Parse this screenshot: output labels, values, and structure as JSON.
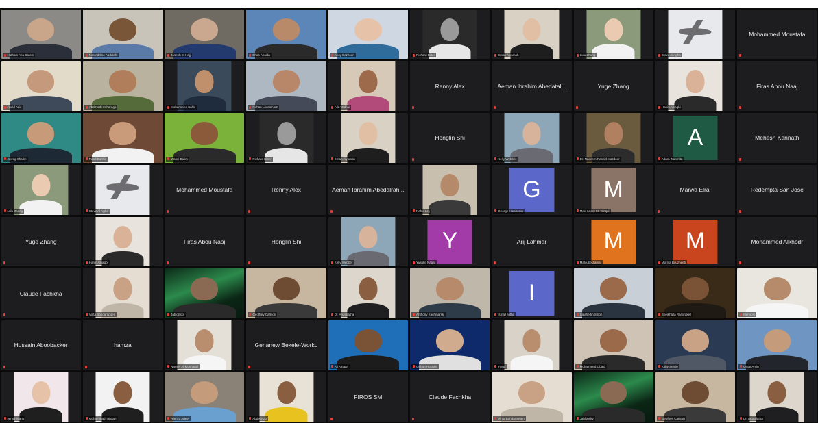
{
  "tiles": [
    {
      "kind": "video",
      "name": "Hatham Abu Salem",
      "bg": "#8c8a86",
      "skin": "#c9a68a",
      "shirt": "#2b2f3a",
      "full": true
    },
    {
      "kind": "video",
      "name": "Nasreddine Abdulahi",
      "bg": "#c9c4b9",
      "skin": "#7a5638",
      "shirt": "#5a7aa8",
      "full": true
    },
    {
      "kind": "video",
      "name": "Joseph El Hajj",
      "bg": "#6f6b63",
      "skin": "#caa78f",
      "shirt": "#233a6e",
      "full": true
    },
    {
      "kind": "video",
      "name": "Ehab Ahaida",
      "bg": "#5d86b8",
      "skin": "#b88a6a",
      "shirt": "#2a2a2a",
      "full": true
    },
    {
      "kind": "video",
      "name": "Ahoy Bazzoun",
      "bg": "#cfd8e2",
      "skin": "#e6c3a8",
      "shirt": "#2f6c9c",
      "full": true
    },
    {
      "kind": "video",
      "name": "Richard Bitter",
      "bg": "#2a2a2a",
      "skin": "#9a9a9a",
      "shirt": "#e6e6e6",
      "full": false
    },
    {
      "kind": "video",
      "name": "Eman Alyamah",
      "bg": "#d9d2c4",
      "skin": "#e0bfa4",
      "shirt": "#1e1e1e",
      "full": false
    },
    {
      "kind": "video",
      "name": "Lulu Zhang",
      "bg": "#8a9a7a",
      "skin": "#eacbb2",
      "shirt": "#f2f2f2",
      "full": false
    },
    {
      "kind": "plane",
      "name": "Steve Al Agha",
      "bg": "#e7e9ec",
      "full": false
    },
    {
      "kind": "text",
      "name": "Mohammed Moustafa"
    },
    {
      "kind": "video",
      "name": "Abdul Aziz",
      "bg": "#e3dbc9",
      "skin": "#c59a7c",
      "shirt": "#3e4a5a",
      "full": true
    },
    {
      "kind": "video",
      "name": "Abd Kader Sharaga",
      "bg": "#b9b29f",
      "skin": "#b07e5b",
      "shirt": "#556b3a",
      "full": true
    },
    {
      "kind": "video",
      "name": "Mohammed Sahir",
      "bg": "#3a4a5a",
      "skin": "#c0906c",
      "shirt": "#1f2c3d",
      "full": false
    },
    {
      "kind": "video",
      "name": "Rohan Lovesmorz",
      "bg": "#aeb8c2",
      "skin": "#b8876a",
      "shirt": "#444a58",
      "full": true
    },
    {
      "kind": "video",
      "name": "Aila Vadhai",
      "bg": "#d6c9b8",
      "skin": "#9e6a4c",
      "shirt": "#b24a7a",
      "full": false
    },
    {
      "kind": "text",
      "name": "Renny Alex"
    },
    {
      "kind": "text",
      "name": "Aeman Ibrahim Abedatal..."
    },
    {
      "kind": "text",
      "name": "Yuge Zhang"
    },
    {
      "kind": "video",
      "name": "Hanin Alnaqbi",
      "bg": "#e8e3dc",
      "skin": "#d9b298",
      "shirt": "#2a2a2a",
      "full": false
    },
    {
      "kind": "text",
      "name": "Firas Abou Naaj"
    },
    {
      "kind": "video",
      "name": "Jaweg Shaikh",
      "bg": "#2f8a86",
      "skin": "#c79b7a",
      "shirt": "#1d2a35",
      "full": true
    },
    {
      "kind": "video",
      "name": "Raad Bachir",
      "bg": "#6e4a36",
      "skin": "#c99b7b",
      "shirt": "#f2f2f2",
      "full": true
    },
    {
      "kind": "video",
      "name": "Wanzi Bajim",
      "bg": "#7bb23a",
      "skin": "#8a5a3a",
      "shirt": "#2a2a2a",
      "full": true
    },
    {
      "kind": "video",
      "name": "Richard Bitter",
      "bg": "#2a2a2a",
      "skin": "#9a9a9a",
      "shirt": "#e6e6e6",
      "full": false
    },
    {
      "kind": "video",
      "name": "Eman Alyamah",
      "bg": "#d9d2c4",
      "skin": "#e0bfa4",
      "shirt": "#1e1e1e",
      "full": false
    },
    {
      "kind": "text",
      "name": "Honglin Shi"
    },
    {
      "kind": "video",
      "name": "Kelly Webber",
      "bg": "#8ea7b8",
      "skin": "#d6b39a",
      "shirt": "#6a6a72",
      "full": false
    },
    {
      "kind": "video",
      "name": "Dr. Nadeem Rashid Mazdoor",
      "bg": "#6a5a3e",
      "skin": "#b08060",
      "shirt": "#2c2c2c",
      "full": false
    },
    {
      "kind": "avatar",
      "letter": "A",
      "color": "#1f5a44",
      "name": "Adam Zammita"
    },
    {
      "kind": "text",
      "name": "Mehesh Kannath"
    },
    {
      "kind": "video",
      "name": "Lulu Zhang",
      "bg": "#8a9a7a",
      "skin": "#eacbb2",
      "shirt": "#f2f2f2",
      "full": false
    },
    {
      "kind": "plane",
      "name": "Steve Al Agha",
      "bg": "#e7e9ec",
      "full": false
    },
    {
      "kind": "text",
      "name": "Mohammed Moustafa"
    },
    {
      "kind": "text",
      "name": "Renny Alex"
    },
    {
      "kind": "text",
      "name": "Aeman Ibrahim Abedalrah..."
    },
    {
      "kind": "video",
      "name": "Nahid Ley",
      "bg": "#c8bfae",
      "skin": "#b58a6a",
      "shirt": "#3a3a3a",
      "full": false
    },
    {
      "kind": "avatar",
      "letter": "G",
      "color": "#5b67c9",
      "name": "George Hambrook"
    },
    {
      "kind": "avatar",
      "letter": "M",
      "color": "#8a7468",
      "name": "Mae Kassy M. Tanqui"
    },
    {
      "kind": "text",
      "name": "Marwa Elrai"
    },
    {
      "kind": "text",
      "name": "Redempta San Jose"
    },
    {
      "kind": "text",
      "name": "Yuge Zhang"
    },
    {
      "kind": "video",
      "name": "Hanin Alnaqbi",
      "bg": "#e8e3dc",
      "skin": "#d9b298",
      "shirt": "#2a2a2a",
      "full": false
    },
    {
      "kind": "text",
      "name": "Firas Abou Naaj"
    },
    {
      "kind": "text",
      "name": "Honglin Shi"
    },
    {
      "kind": "video",
      "name": "Kelly Webber",
      "bg": "#8ea7b8",
      "skin": "#d6b39a",
      "shirt": "#6a6a72",
      "full": false
    },
    {
      "kind": "avatar",
      "letter": "Y",
      "color": "#a23aa8",
      "name": "Yusuke Nagai"
    },
    {
      "kind": "text",
      "name": "Arij Lahmar"
    },
    {
      "kind": "avatar",
      "letter": "M",
      "color": "#e0731e",
      "name": "Maloube Zamar"
    },
    {
      "kind": "avatar",
      "letter": "M",
      "color": "#c9451e",
      "name": "Morina Bouzheeb"
    },
    {
      "kind": "text",
      "name": "Mohammed Alkhodr"
    },
    {
      "kind": "text",
      "name": "Claude Fachkha"
    },
    {
      "kind": "video",
      "name": "Vinta Bandaragoen",
      "bg": "#e6ddd2",
      "skin": "#c9a184",
      "shirt": "#c0b6a8",
      "full": false
    },
    {
      "kind": "aurora",
      "name": "Jablonsky",
      "full": true
    },
    {
      "kind": "video",
      "name": "Geoffrey Carlson",
      "bg": "#c8b7a0",
      "skin": "#6e4c34",
      "shirt": "#3a3a3a",
      "full": true
    },
    {
      "kind": "video",
      "name": "Dr. Arunalatha",
      "bg": "#dcd6cc",
      "skin": "#8a5e40",
      "shirt": "#1f1f22",
      "full": false
    },
    {
      "kind": "video",
      "name": "Anthony Kachmarski",
      "bg": "#bfb7aa",
      "skin": "#b88a6c",
      "shirt": "#2e3b48",
      "full": true
    },
    {
      "kind": "avatar",
      "letter": "I",
      "color": "#5b67c9",
      "name": "Ismail Mitha"
    },
    {
      "kind": "video",
      "name": "Salahedin Singh",
      "bg": "#c9cfd6",
      "skin": "#9a6a4a",
      "shirt": "#2a3340",
      "full": true
    },
    {
      "kind": "video",
      "name": "Sheikhalla Ramirakez",
      "bg": "#3a2a18",
      "skin": "#7a5236",
      "shirt": "#1f1a14",
      "full": true
    },
    {
      "kind": "video",
      "name": "Mehsom",
      "bg": "#e9e6e0",
      "skin": "#b58b6b",
      "shirt": "#f5f5f5",
      "full": true
    },
    {
      "kind": "text",
      "name": "Hussain Aboobacker"
    },
    {
      "kind": "text",
      "name": "hamza"
    },
    {
      "kind": "video",
      "name": "Nasser Al Mushaqqi",
      "bg": "#e4e0d8",
      "skin": "#b88e6e",
      "shirt": "#f5f5f5",
      "full": false
    },
    {
      "kind": "text",
      "name": "Genanew Bekele-Worku"
    },
    {
      "kind": "video",
      "name": "Ali Amaan",
      "bg": "#1e6fb8",
      "skin": "#7a5236",
      "shirt": "#1c1c1c",
      "full": true
    },
    {
      "kind": "video",
      "name": "Gehan Hussain",
      "bg": "#0f2a6a",
      "skin": "#d0ab8e",
      "shirt": "#e0e0e0",
      "full": true
    },
    {
      "kind": "video",
      "name": "Yusuf",
      "bg": "#d8d2c8",
      "skin": "#b88e6e",
      "shirt": "#f5f5f5",
      "full": false
    },
    {
      "kind": "video",
      "name": "Mohammed Obaid",
      "bg": "#cfc3b6",
      "skin": "#9a6a4a",
      "shirt": "#2a2a2a",
      "full": true
    },
    {
      "kind": "video",
      "name": "Kithy Sentie",
      "bg": "#2a3a52",
      "skin": "#c9a184",
      "shirt": "#505866",
      "full": true
    },
    {
      "kind": "video",
      "name": "Omar Amin",
      "bg": "#6f96c2",
      "skin": "#c49b7b",
      "shirt": "#22262c",
      "full": true
    },
    {
      "kind": "video",
      "name": "Jenny Wang",
      "bg": "#f1e7ea",
      "skin": "#e6c3a8",
      "shirt": "#1f1f1f",
      "full": false
    },
    {
      "kind": "video",
      "name": "Muhammad Tahaan",
      "bg": "#f2f2f2",
      "skin": "#8a5e40",
      "shirt": "#1f1f1f",
      "full": false
    },
    {
      "kind": "video",
      "name": "Hamza Aqeel",
      "bg": "#8a8276",
      "skin": "#c49b7b",
      "shirt": "#6aa0d0",
      "full": true
    },
    {
      "kind": "video",
      "name": "Abdel Aziz",
      "bg": "#e8e2d6",
      "skin": "#8a5e40",
      "shirt": "#e8c21e",
      "full": false
    },
    {
      "kind": "text",
      "name": "FIROS SM"
    },
    {
      "kind": "text",
      "name": "Claude Fachkha"
    },
    {
      "kind": "video",
      "name": "Vinta Bandaragoen",
      "bg": "#e6ddd2",
      "skin": "#c9a184",
      "shirt": "#c0b6a8",
      "full": true
    },
    {
      "kind": "aurora",
      "name": "Jablonsky",
      "full": true
    },
    {
      "kind": "video",
      "name": "Geoffrey Carlson",
      "bg": "#c8b7a0",
      "skin": "#6e4c34",
      "shirt": "#3a3a3a",
      "full": true
    },
    {
      "kind": "video",
      "name": "Dr. Arunalatha",
      "bg": "#dcd6cc",
      "skin": "#8a5e40",
      "shirt": "#1f1f22",
      "full": false
    }
  ]
}
